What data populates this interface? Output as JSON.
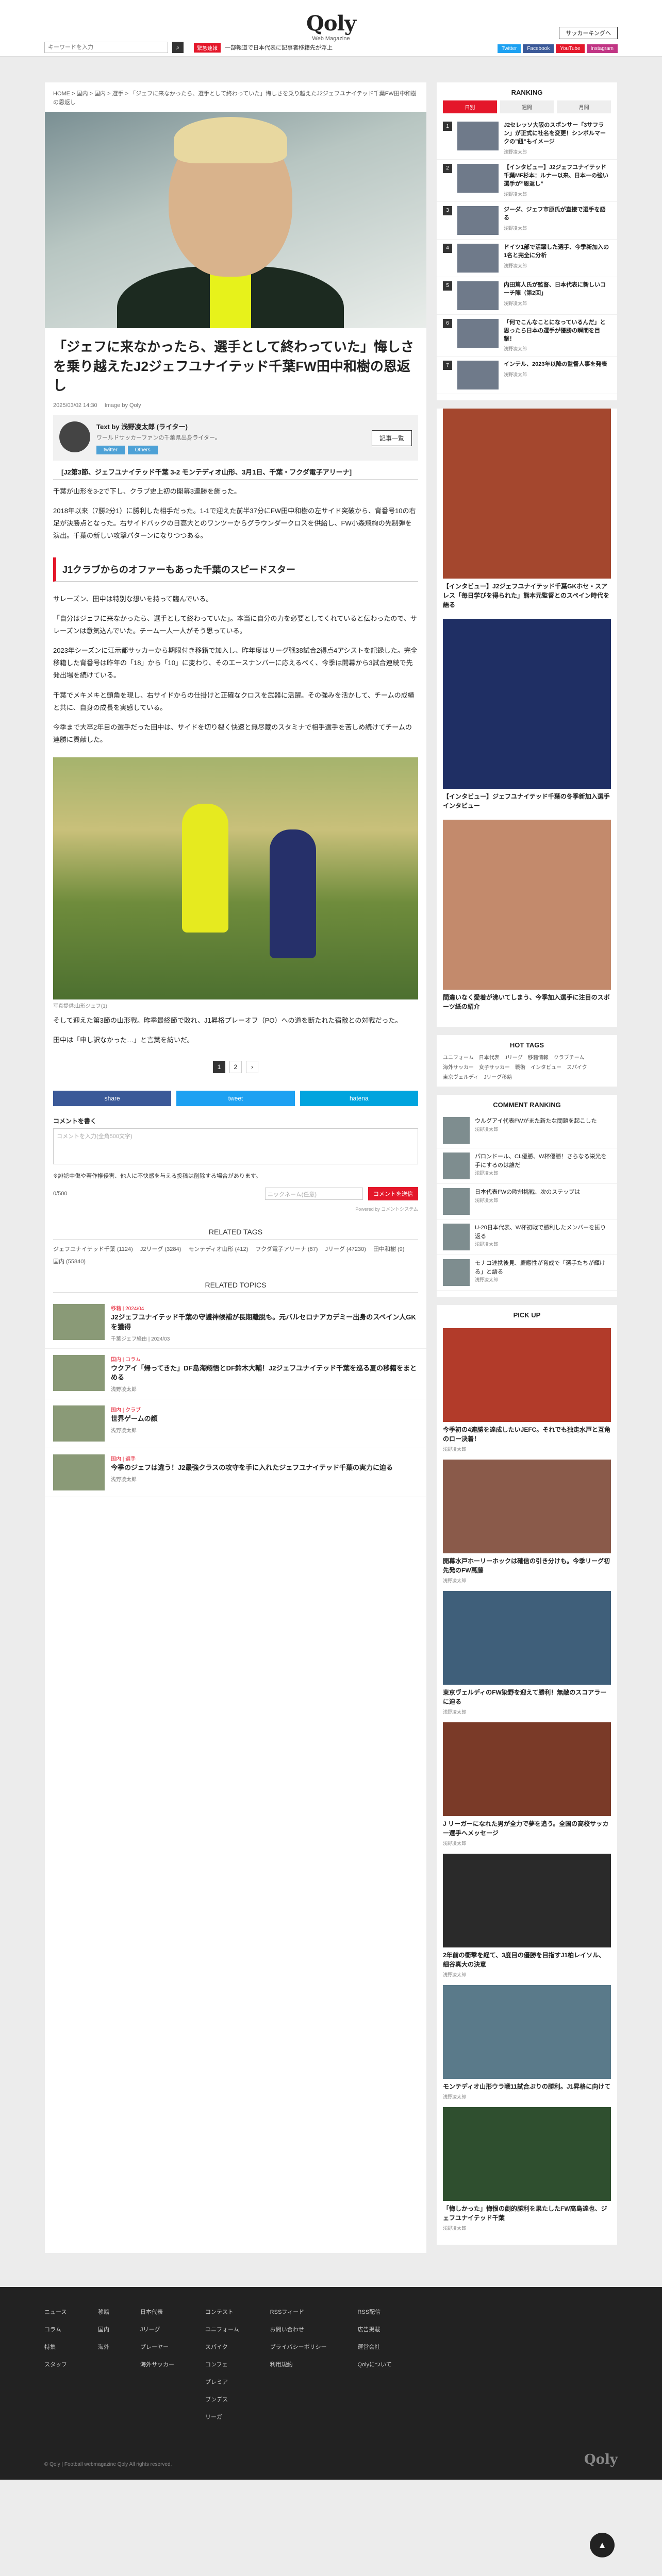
{
  "header": {
    "logo": "Qoly",
    "logo_sub": "Web Magazine",
    "search_placeholder": "キーワードを入力",
    "hot_badge": "緊急速報",
    "hot_text": "一部報道で日本代表に記事者移籍先が浮上",
    "soccer_king": "サッカーキングへ",
    "social": [
      {
        "label": "Twitter",
        "color": "#1da1f2"
      },
      {
        "label": "Facebook",
        "color": "#3b5998"
      },
      {
        "label": "YouTube",
        "color": "#e4172a"
      },
      {
        "label": "Instagram",
        "color": "#c13584"
      }
    ]
  },
  "breadcrumb": "HOME > 国内 > 国内 > 選手 > 「ジェフに来なかったら、選手として終わっていた」悔しさを乗り越えたJ2ジェフユナイテッド千葉FW田中和樹の恩返し",
  "article": {
    "title": "「ジェフに来なかったら、選手として終わっていた」悔しさを乗り越えたJ2ジェフユナイテッド千葉FW田中和樹の恩返し",
    "date": "2025/03/02 14:30",
    "image_credit": "Image by Qoly",
    "author": {
      "name": "浅野凌太郎 (ライター)",
      "prefix": "Text by",
      "desc": "ワールドサッカーファンの千葉県出身ライター。",
      "links": [
        "twitter",
        "Others"
      ],
      "follow": "記事一覧"
    },
    "game_line": "[J2第3節、ジェフユナイテッド千葉 3-2 モンテディオ山形、3月1日、千葉・フクダ電子アリーナ]",
    "paragraphs": [
      "千葉が山形を3-2で下し、クラブ史上初の開幕3連勝を飾った。",
      "2018年以来（7勝2分1）に勝利した相手だった。1-1で迎えた前半37分にFW田中和樹の左サイド突破から、背番号10の右足が決勝点となった。右サイドバックの日高大とのワンツーからグラウンダークロスを供給し、FW小森飛絢の先制弾を演出。千葉の新しい攻撃パターンになりつつある。"
    ],
    "heading": "J1クラブからのオファーもあった千葉のスピードスター",
    "paragraphs2": [
      "サレーズン、田中は特別な想いを持って臨んでいる。",
      "「自分はジェフに来なかったら、選手として終わっていた」。本当に自分の力を必要としてくれていると伝わったので、サレーズンは意気込んでいた。チーム一人一人がそう思っている。",
      "2023年シーズンに江示都サッカーから期限付き移籍で加入し、昨年度はリーグ戦38試合2得点4アシストを記録した。完全移籍した背番号は昨年の「18」から「10」に変わり、そのエースナンバーに応えるべく、今季は開幕から3試合連続で先発出場を続けている。",
      "千葉でメキメキと頭角を現し、右サイドからの仕掛けと正確なクロスを武器に活躍。その強みを活かして、チームの成績と共に、自身の成長を実感している。",
      "今季まで大卒2年目の選手だった田中は、サイドを切り裂く快速と無尽蔵のスタミナで相手選手を苦しめ続けてチームの連勝に貢献した。"
    ],
    "photo_caption": "写真提供:山形ジェフ(1)",
    "paragraphs3": [
      "そして迎えた第3節の山形戦。昨季最終節で敗れ、J1昇格プレーオフ（PO）への道を断たれた宿敵との対戦だった。",
      "田中は「申し訳なかった…」と言葉を紡いだ。"
    ],
    "pager": [
      "1",
      "2",
      "›"
    ]
  },
  "share": [
    {
      "label": "share",
      "color": "#3b5998"
    },
    {
      "label": "tweet",
      "color": "#1da1f2"
    },
    {
      "label": "hatena",
      "color": "#00a4de"
    }
  ],
  "comments": {
    "label": "コメントを書く",
    "placeholder": "コメントを入力(全角500文字)",
    "notice": "※誹謗中傷や著作権侵害、他人に不快感を与える投稿は削除する場合があります。",
    "count": "0/500",
    "nickname_placeholder": "ニックネーム(任意)",
    "submit": "コメントを送信",
    "powered": "Powered by コメントシステム"
  },
  "related_tags": {
    "title": "RELATED TAGS",
    "items": [
      "ジェフユナイテッド千葉 (1124)",
      "J2リーグ (3284)",
      "モンテディオ山形 (412)",
      "フクダ電子アリーナ (87)",
      "Jリーグ (47230)",
      "田中和樹 (9)",
      "国内 (55840)"
    ]
  },
  "related_topics": {
    "title": "RELATED TOPICS",
    "items": [
      {
        "cat": "移籍 | 2024/04",
        "title": "J2ジェフユナイテッド千葉の守護神候補が長期離脱も。元バルセロナアカデミー出身のスペイン人GKを獲得",
        "sub": "千葉ジェフ経由 | 2024/03"
      },
      {
        "cat": "国内 | コラム",
        "title": "ウクアイ「帰ってきた」DF島海翔悟とDF鈴木大輔！J2ジェフユナイテッド千葉を巡る夏の移籍をまとめる",
        "sub": "浅野凌太郎"
      },
      {
        "cat": "国内 | クラブ",
        "title": "世界ゲームの顔",
        "sub": "浅野凌太郎"
      },
      {
        "cat": "国内 | 選手",
        "title": "今季のジェフは違う！J2最強クラスの攻守を手に入れたジェフユナイテッド千葉の実力に迫る",
        "sub": "浅野凌太郎"
      }
    ]
  },
  "sidebar": {
    "ranking": {
      "title": "RANKING",
      "tabs": [
        "日別",
        "週間",
        "月間"
      ],
      "items": [
        {
          "title": "J2セレッソ大阪のスポンサー「3サフラン」が正式に社名を変更！シンボルマークの”紐”もイメージ",
          "sub": "浅野凌太郎"
        },
        {
          "title": "【インタビュー】J2ジェフユナイテッド千葉MF杉本：ルナー以来、日本一の強い選手が”恩返し”",
          "sub": "浅野凌太郎"
        },
        {
          "title": "ジーダ、ジェフ市原氏が直接で選手を語る",
          "sub": "浅野凌太郎"
        },
        {
          "title": "ドイツ1部で活躍した選手、今季新加入の1名と完全に分析",
          "sub": "浅野凌太郎"
        },
        {
          "title": "内田篤人氏が監督、日本代表に新しいコーチ陣（第2回」",
          "sub": "浅野凌太郎"
        },
        {
          "title": "「何でこんなことになっているんだ」と思ったら日本の選手が優勝の瞬間を目撃！",
          "sub": "浅野凌太郎"
        },
        {
          "title": "インテル、2023年以降の監督人事を発表",
          "sub": "浅野凌太郎"
        }
      ]
    },
    "promos": [
      {
        "title": "【インタビュー】J2ジェフユナイテッド千葉GKホセ・スアレス「毎日学びを得られた」熊本元監督とのスペイン時代を語る"
      },
      {
        "title": "【インタビュー】ジェフユナイテッド千葉の冬季新加入選手インタビュー"
      },
      {
        "title": "間違いなく愛着が沸いてしまう、今季加入選手に注目のスポーツ紙の紹介"
      }
    ],
    "hot_tags": {
      "title": "HOT TAGS",
      "items": [
        "ユニフォーム",
        "日本代表",
        "Jリーグ",
        "移籍情報",
        "クラブチーム",
        "海外サッカー",
        "女子サッカー",
        "戦術",
        "インタビュー",
        "スパイク",
        "東京ヴェルディ",
        "Jリーグ移籍"
      ]
    },
    "comment_ranking": {
      "title": "COMMENT RANKING",
      "items": [
        {
          "title": "ウルグアイ代表FWがまた新たな問題を起こした",
          "sub": "浅野凌太郎"
        },
        {
          "title": "パロンドール、CL優勝、W杯優勝！さらなる栄光を手にするのは誰だ",
          "sub": "浅野凌太郎"
        },
        {
          "title": "日本代表FWの欧州挑戦、次のステップは",
          "sub": "浅野凌太郎"
        },
        {
          "title": "U-20日本代表、W杯初戦で勝利したメンバーを振り返る",
          "sub": "浅野凌太郎"
        },
        {
          "title": "モナコ連携後見、慶應性が育成で「選手たちが輝ける」と語る",
          "sub": "浅野凌太郎"
        }
      ]
    },
    "pick_up": {
      "title": "PICK UP",
      "items": [
        {
          "title": "今季初の4連勝を達成したいJEFC。それでも独走水戸と互角のロー決着！",
          "sub": "浅野凌太郎"
        },
        {
          "title": "開幕水戸ホーリーホックは確信の引き分けも。今季リーグ初先発のFW萬藤",
          "sub": "浅野凌太郎"
        },
        {
          "title": "東京ヴェルディのFW染野を迎えて勝利！無敵のスコアラーに迫る",
          "sub": "浅野凌太郎"
        },
        {
          "title": "J リーガーになれた男が全力で夢を追う。全国の高校サッカー選手へメッセージ",
          "sub": "浅野凌太郎"
        },
        {
          "title": "2年前の衝撃を経て、3度目の優勝を目指すJ1柏レイソル、細谷真大の決意",
          "sub": "浅野凌太郎"
        },
        {
          "title": "モンテディオ山形ウラ戦11試合ぶりの勝利。J1昇格に向けて",
          "sub": "浅野凌太郎"
        },
        {
          "title": "「悔しかった」悔恨の劇的勝利を果たしたFW高島達也、ジェフユナイテッド千葉",
          "sub": "浅野凌太郎"
        }
      ]
    }
  },
  "footer": {
    "cols": [
      [
        "ニュース",
        "コラム",
        "特集",
        "スタッフ"
      ],
      [
        "移籍",
        "国内",
        "海外"
      ],
      [
        "日本代表",
        "Jリーグ",
        "プレーヤー",
        "海外サッカー"
      ],
      [
        "コンテスト",
        "ユニフォーム",
        "スパイク",
        "コンフェ",
        "プレミア",
        "ブンデス",
        "リーガ"
      ],
      [
        "RSSフィード",
        "お問い合わせ",
        "プライバシーポリシー",
        "利用規約"
      ],
      [
        "RSS配信",
        "広告掲載",
        "運営会社",
        "Qolyについて"
      ]
    ],
    "copyright": "© Qoly | Football webmagazine Qoly All rights reserved.",
    "logo": "Qoly"
  }
}
